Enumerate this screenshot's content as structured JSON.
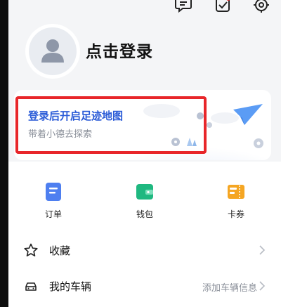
{
  "colors": {
    "accent_blue": "#2a5bd7",
    "highlight_red": "#e8262a",
    "orders_blue": "#4e7ff0",
    "wallet_green": "#1fb880",
    "coupons_orange": "#f5a623"
  },
  "header": {
    "icons": [
      "message-icon",
      "checkin-icon",
      "settings-icon"
    ]
  },
  "profile": {
    "login_label": "点击登录"
  },
  "banner": {
    "title": "登录后开启足迹地图",
    "subtitle": "带着小德去探索"
  },
  "quick_actions": [
    {
      "label": "订单",
      "icon": "orders-icon"
    },
    {
      "label": "钱包",
      "icon": "wallet-icon"
    },
    {
      "label": "卡券",
      "icon": "coupon-icon"
    }
  ],
  "menu": [
    {
      "label": "收藏",
      "extra": "",
      "icon": "star-icon"
    },
    {
      "label": "我的车辆",
      "extra": "添加车辆信息",
      "icon": "car-icon"
    }
  ]
}
